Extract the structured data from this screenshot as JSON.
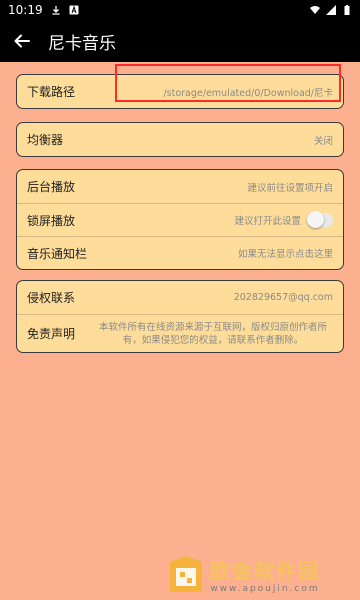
{
  "status_bar": {
    "time": "10:19"
  },
  "app_bar": {
    "title": "尼卡音乐"
  },
  "download": {
    "label": "下载路径",
    "value": "/storage/emulated/0/Download/尼卡"
  },
  "equalizer": {
    "label": "均衡器",
    "value": "关闭"
  },
  "playback": {
    "background_label": "后台播放",
    "background_value": "建议前往设置项开启",
    "lockscreen_label": "锁屏播放",
    "lockscreen_value": "建议打开此设置",
    "lockscreen_enabled": false,
    "notification_label": "音乐通知栏",
    "notification_value": "如果无法显示点击这里"
  },
  "about": {
    "copyright_label": "侵权联系",
    "copyright_value": "202829657@qq.com",
    "disclaimer_label": "免责声明",
    "disclaimer_line1": "本软件所有在线资源来源于互联网，版权归原创作者所",
    "disclaimer_line2": "有，如果侵犯您的权益，请联系作者删除。"
  },
  "watermark": {
    "title": "欧金软件园",
    "url": "www.apoujin.com"
  },
  "colors": {
    "background": "#fdb08f",
    "card": "#fedd9a",
    "highlight": "#ff2a2a"
  }
}
